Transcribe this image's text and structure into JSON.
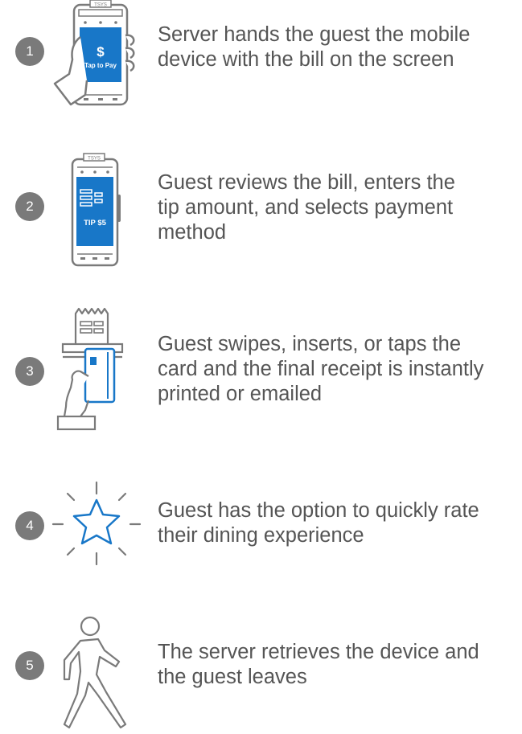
{
  "colors": {
    "gray": "#7a7a7a",
    "blue": "#1877c8",
    "text": "#555555"
  },
  "steps": [
    {
      "number": "1",
      "icon": "hand-holding-phone-icon",
      "screen_amount": "$",
      "screen_label": "Tap to Pay",
      "device_brand": "TSYS",
      "text_line1": "Server hands the guest the mobile",
      "text_line2": "device with the bill on the screen"
    },
    {
      "number": "2",
      "icon": "tablet-bill-icon",
      "screen_label": "TIP $5",
      "device_brand": "TSYS",
      "text_line1": "Guest reviews the bill, enters the",
      "text_line2": "tip amount, and selects payment",
      "text_line3": "method"
    },
    {
      "number": "3",
      "icon": "card-receipt-icon",
      "text_line1": "Guest swipes, inserts, or taps the",
      "text_line2": "card and the final receipt is instantly",
      "text_line3": "printed or emailed"
    },
    {
      "number": "4",
      "icon": "star-rating-icon",
      "text_line1": "Guest has the option to quickly rate",
      "text_line2": "their dining experience"
    },
    {
      "number": "5",
      "icon": "walking-person-icon",
      "text_line1": "The server retrieves the device and",
      "text_line2": "the guest leaves"
    }
  ]
}
